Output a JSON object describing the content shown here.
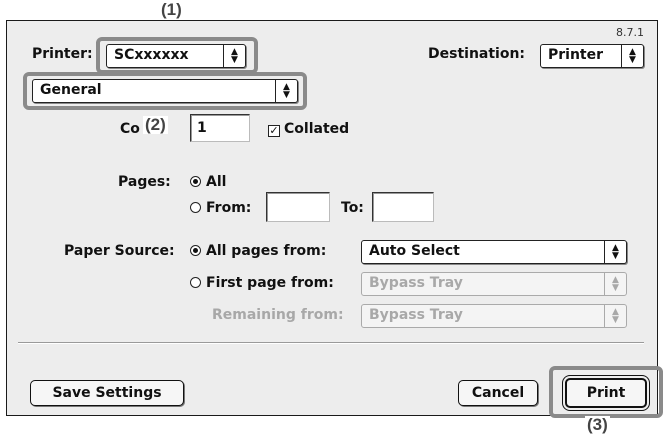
{
  "version": "8.7.1",
  "printer": {
    "label": "Printer:",
    "value": "SCxxxxxx"
  },
  "destination": {
    "label": "Destination:",
    "value": "Printer"
  },
  "panel_menu": {
    "value": "General"
  },
  "copies": {
    "label": "Co",
    "value": "1"
  },
  "collated": {
    "label": "Collated",
    "checked": true
  },
  "pages": {
    "label": "Pages:",
    "all_label": "All",
    "from_label": "From:",
    "to_label": "To:",
    "from_value": "",
    "to_value": "",
    "selected": "All"
  },
  "paper_source": {
    "label": "Paper Source:",
    "all_pages_label": "All pages from:",
    "all_pages_value": "Auto Select",
    "first_page_label": "First page from:",
    "first_page_value": "Bypass Tray",
    "remaining_label": "Remaining from:",
    "remaining_value": "Bypass Tray",
    "selected": "All pages from:"
  },
  "buttons": {
    "save_settings": "Save Settings",
    "cancel": "Cancel",
    "print": "Print"
  },
  "callouts": {
    "c1": "(1)",
    "c2": "(2)",
    "c3": "(3)"
  },
  "colors": {
    "dialog_bg": "#ededed",
    "callout_border": "#8a8a8a"
  }
}
